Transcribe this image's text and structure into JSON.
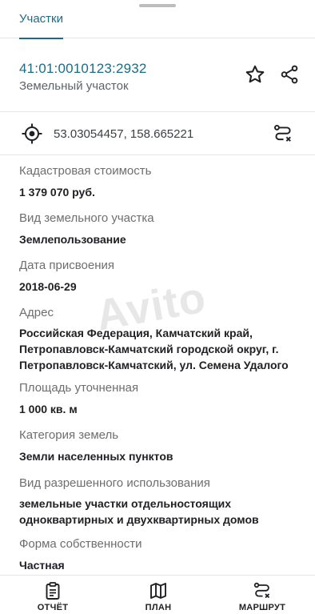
{
  "tabs": [
    {
      "label": "Участки",
      "active": true
    }
  ],
  "parcel": {
    "cadastral_number": "41:01:0010123:2932",
    "object_type": "Земельный участок"
  },
  "location": {
    "coordinates": "53.03054457, 158.665221"
  },
  "properties": [
    {
      "label": "Кадастровая стоимость",
      "value": "1 379 070 руб."
    },
    {
      "label": "Вид земельного участка",
      "value": "Землепользование"
    },
    {
      "label": "Дата присвоения",
      "value": "2018-06-29"
    },
    {
      "label": "Адрес",
      "value": "Российская Федерация, Камчатский край, Петропавловск-Камчатский городской округ, г. Петропавловск-Камчатский, ул. Семена Удалого"
    },
    {
      "label": "Площадь уточненная",
      "value": "1 000 кв. м"
    },
    {
      "label": "Категория земель",
      "value": "Земли населенных пунктов"
    },
    {
      "label": "Вид разрешенного использования",
      "value": "земельные участки отдельностоящих одноквартирных и двухквартирных домов"
    },
    {
      "label": "Форма собственности",
      "value": "Частная"
    }
  ],
  "watermark": "Avito",
  "bottom_nav": {
    "report": "ОТЧЁТ",
    "plan": "ПЛАН",
    "route": "МАРШРУТ"
  },
  "colors": {
    "accent": "#1e6b86",
    "text": "#202124",
    "label": "#6e6e6e"
  }
}
